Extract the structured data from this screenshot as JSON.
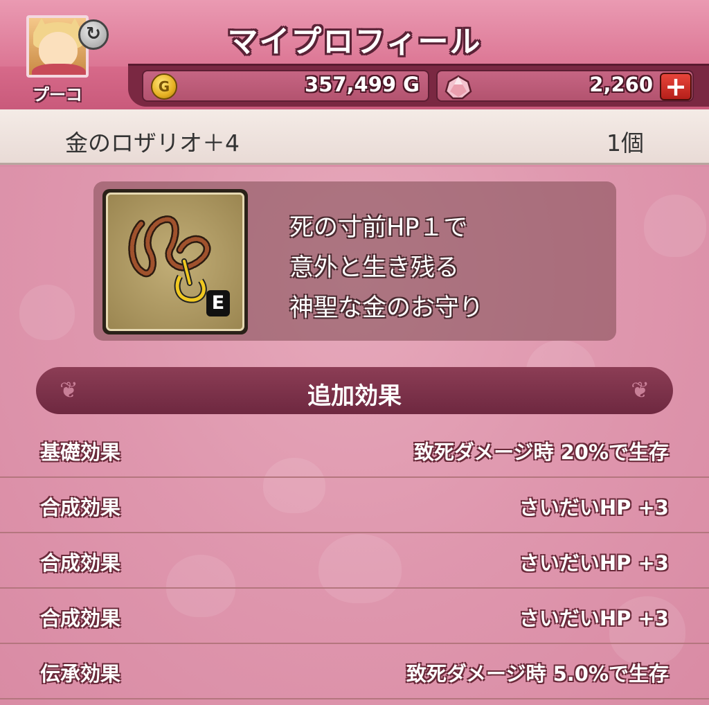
{
  "header": {
    "title": "マイプロフィール",
    "player_name": "プーコ",
    "gold": {
      "value": "357,499 G",
      "icon": "gold-coin-icon"
    },
    "gems": {
      "value": "2,260",
      "icon": "gem-icon",
      "add_label": "+"
    }
  },
  "item": {
    "name": "金のロザリオ＋4",
    "count": "1個",
    "equipped_badge": "E",
    "description": [
      "死の寸前HP１で",
      "意外と生き残る",
      "神聖な金のお守り"
    ]
  },
  "effects": {
    "section_title": "追加効果",
    "rows": [
      {
        "label": "基礎効果",
        "value": "致死ダメージ時  20%で生存"
      },
      {
        "label": "合成効果",
        "value": "さいだいHP  +3"
      },
      {
        "label": "合成効果",
        "value": "さいだいHP  +3"
      },
      {
        "label": "合成効果",
        "value": "さいだいHP  +3"
      },
      {
        "label": "伝承効果",
        "value": "致死ダメージ時  5.0%で生存"
      }
    ]
  },
  "colors": {
    "header_pink": "#dc7694",
    "band_dark": "#7a2842",
    "content_pink": "#df97ae",
    "section_header": "#7d3249"
  }
}
